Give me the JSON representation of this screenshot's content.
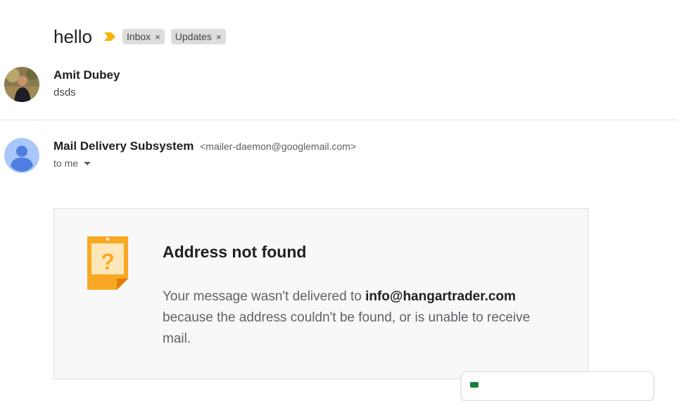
{
  "thread": {
    "subject": "hello",
    "labels": [
      {
        "text": "Inbox",
        "remove": "×"
      },
      {
        "text": "Updates",
        "remove": "×"
      }
    ]
  },
  "message1": {
    "sender_name": "Amit Dubey",
    "snippet": "dsds"
  },
  "message2": {
    "sender_name": "Mail Delivery Subsystem",
    "sender_email": "<mailer-daemon@googlemail.com>",
    "recipient": "to me"
  },
  "bounce": {
    "title": "Address not found",
    "body_prefix": "Your message wasn't delivered to ",
    "address": "info@hangartrader.com",
    "body_suffix": " because the address couldn't be found, or is unable to receive mail."
  },
  "colors": {
    "importance": "#f4b400",
    "bounce_icon": "#f9a825",
    "default_avatar_bg": "#a8c7fa",
    "default_avatar_fg": "#4f7ee0"
  }
}
